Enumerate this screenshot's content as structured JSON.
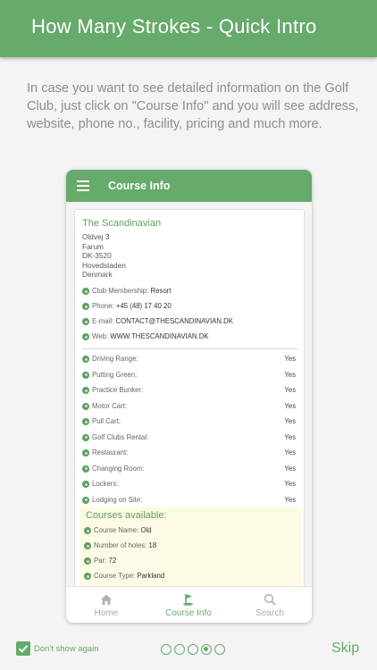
{
  "header": {
    "title": "How Many Strokes - Quick Intro"
  },
  "intro_text": "In case you want to see detailed information on the Golf Club, just click on \"Course Info\" and you will see address, website, phone no., facility, pricing and much more.",
  "phone": {
    "title": "Course Info",
    "club": {
      "name": "The Scandinavian",
      "address": [
        "Oldvej 3",
        "Farum",
        "DK-3520",
        "Hovedstaden",
        "Denmark"
      ]
    },
    "contact": [
      {
        "label": "Club Membership:",
        "value": "Resort"
      },
      {
        "label": "Phone:",
        "value": "+45 (48) 17 40 20"
      },
      {
        "label": "E-mail:",
        "value": "CONTACT@THESCANDINAVIAN.DK"
      },
      {
        "label": "Web:",
        "value": "WWW.THESCANDINAVIAN.DK"
      }
    ],
    "facilities": [
      {
        "label": "Driving Range:",
        "value": "Yes"
      },
      {
        "label": "Putting Green:",
        "value": "Yes"
      },
      {
        "label": "Practice Bunker:",
        "value": "Yes"
      },
      {
        "label": "Motor Cart:",
        "value": "Yes"
      },
      {
        "label": "Pull Cart:",
        "value": "Yes"
      },
      {
        "label": "Golf Clubs Rental:",
        "value": "Yes"
      },
      {
        "label": "Restaurant:",
        "value": "Yes"
      },
      {
        "label": "Changing Room:",
        "value": "Yes"
      },
      {
        "label": "Lockers:",
        "value": "Yes"
      },
      {
        "label": "Lodging on Site:",
        "value": "Yes"
      }
    ],
    "courses": {
      "title": "Courses available:",
      "items": [
        {
          "label": "Course Name:",
          "value": "Old"
        },
        {
          "label": "Number of holes:",
          "value": "18"
        },
        {
          "label": "Par:",
          "value": "72"
        },
        {
          "label": "Course Type:",
          "value": "Parkland"
        }
      ]
    },
    "tabs": [
      {
        "label": "Home",
        "icon": "home-icon",
        "active": false
      },
      {
        "label": "Course Info",
        "icon": "golf-flag-icon",
        "active": true
      },
      {
        "label": "Search",
        "icon": "search-icon",
        "active": false
      }
    ]
  },
  "footer": {
    "dont_show_label": "Don't show again",
    "dont_show_checked": true,
    "pager": {
      "total": 5,
      "current": 4
    },
    "skip_label": "Skip"
  },
  "colors": {
    "accent": "#66aa6c",
    "accent_dark": "#5e9e62",
    "courses_bg": "#fdfbe6"
  }
}
